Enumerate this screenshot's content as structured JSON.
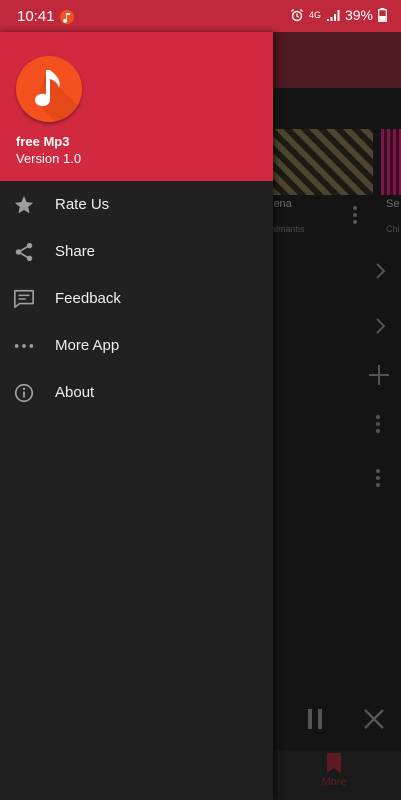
{
  "status_bar": {
    "time": "10:41",
    "network": "4G",
    "battery": "39%"
  },
  "drawer": {
    "header": {
      "app_name": "free Mp3",
      "version": "Version 1.0",
      "logo_icon": "music-note-icon",
      "header_color": "#d1293f",
      "logo_color": "#f4511e"
    },
    "menu": [
      {
        "label": "Rate Us",
        "icon": "star-icon"
      },
      {
        "label": "Share",
        "icon": "share-icon"
      },
      {
        "label": "Feedback",
        "icon": "feedback-icon"
      },
      {
        "label": "More App",
        "icon": "more-horizontal-icon"
      },
      {
        "label": "About",
        "icon": "info-icon"
      }
    ]
  },
  "background": {
    "card1_title": "lena",
    "card1_subtitle": "almantis",
    "card2_title": "Se",
    "card2_subtitle": "Chi",
    "bottom_nav_label": "More"
  }
}
